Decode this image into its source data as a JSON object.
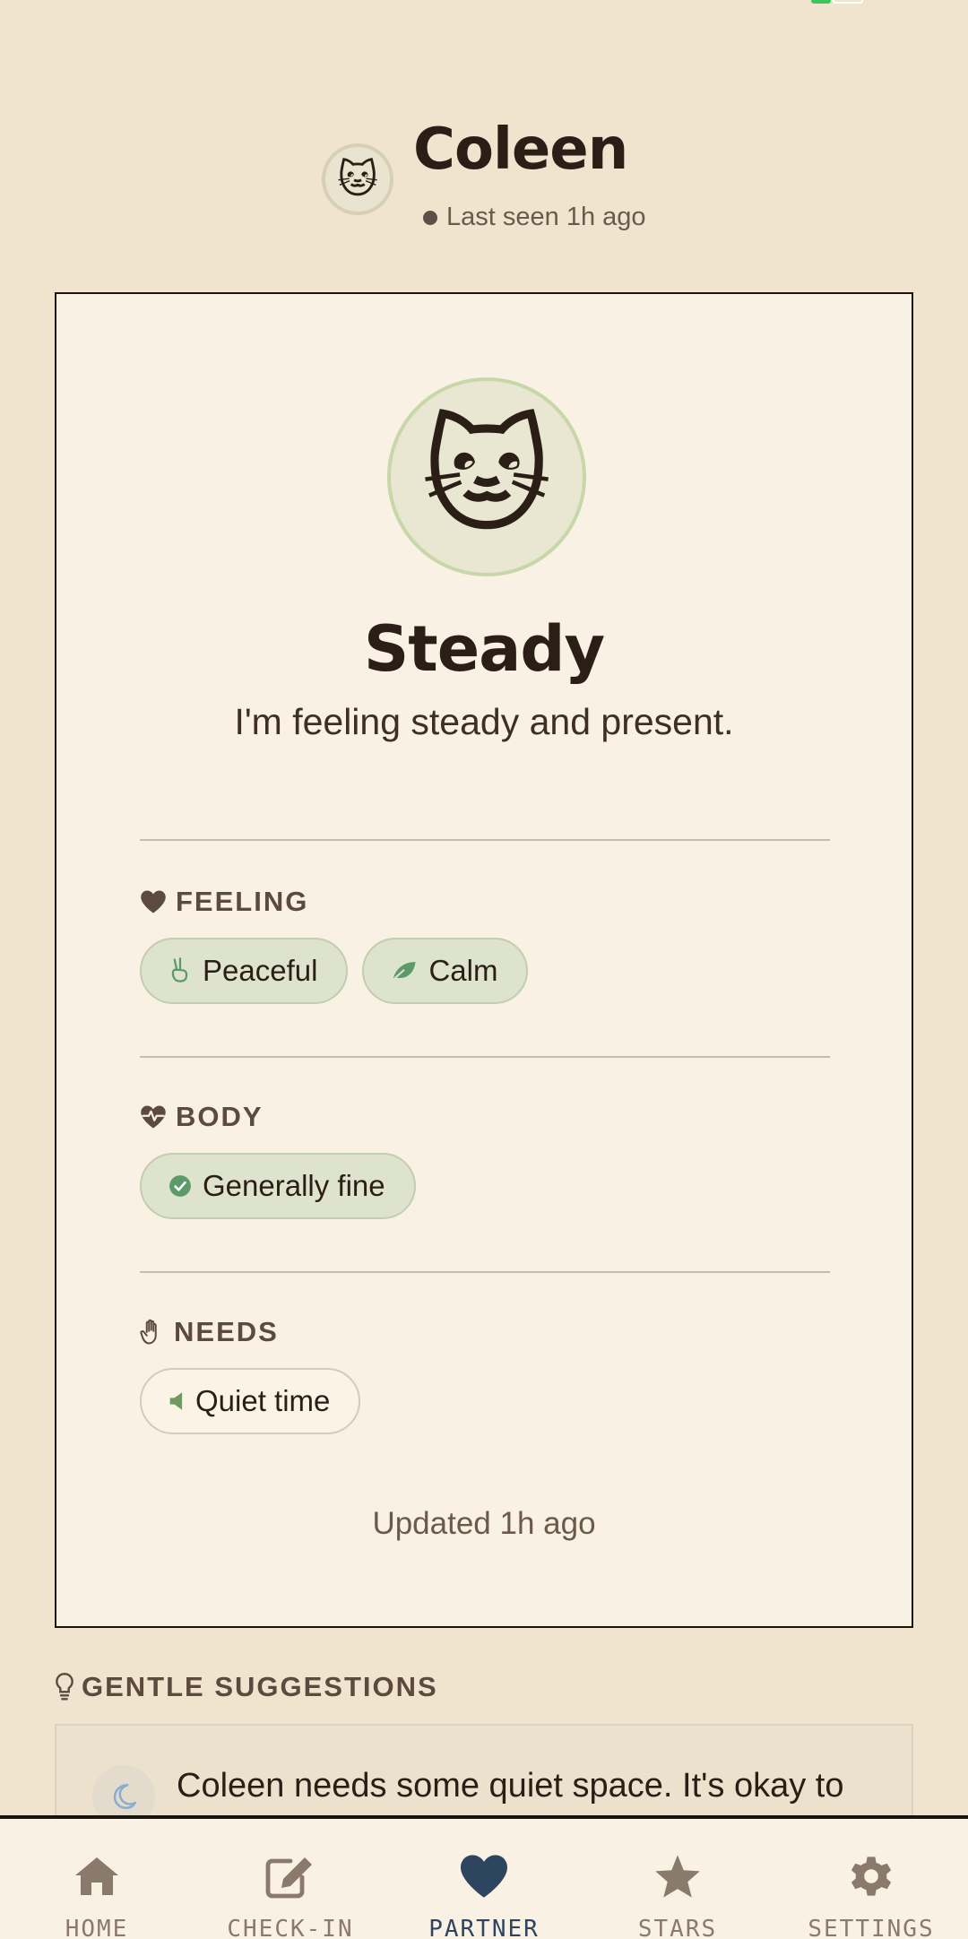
{
  "header": {
    "avatar_emoji": "🐱",
    "name": "Coleen",
    "presence": "Last seen 1h ago"
  },
  "card": {
    "avatar_emoji": "🐱",
    "mood_title": "Steady",
    "mood_subtitle": "I'm feeling steady and present.",
    "sections": {
      "feeling": {
        "label": "FEELING",
        "icon": "heart-icon",
        "chips": [
          {
            "label": "Peaceful",
            "icon": "peace-hand-icon"
          },
          {
            "label": "Calm",
            "icon": "leaf-icon"
          }
        ]
      },
      "body": {
        "label": "BODY",
        "icon": "heart-pulse-icon",
        "chips": [
          {
            "label": "Generally fine",
            "icon": "check-circle-icon"
          }
        ]
      },
      "needs": {
        "label": "NEEDS",
        "icon": "hand-icon",
        "chips": [
          {
            "label": "Quiet time",
            "icon": "speaker-low-icon"
          }
        ]
      }
    },
    "updated": "Updated 1h ago"
  },
  "suggestions": {
    "label": "GENTLE SUGGESTIONS",
    "icon": "lightbulb-icon",
    "items": [
      {
        "icon": "moon-icon",
        "text": "Coleen needs some quiet space. It's okay to"
      }
    ]
  },
  "nav": {
    "active": "partner",
    "items": [
      {
        "id": "home",
        "label": "HOME",
        "icon": "home-icon"
      },
      {
        "id": "checkin",
        "label": "CHECK-IN",
        "icon": "edit-icon"
      },
      {
        "id": "partner",
        "label": "PARTNER",
        "icon": "heart-icon"
      },
      {
        "id": "stars",
        "label": "STARS",
        "icon": "star-icon"
      },
      {
        "id": "settings",
        "label": "SETTINGS",
        "icon": "gear-icon"
      }
    ]
  },
  "colors": {
    "background": "#f0e4cf",
    "card": "#f9f1e3",
    "chip_green": "#dde3cc",
    "nav_active": "#2e4560",
    "nav_inactive": "#8a7a6c"
  }
}
